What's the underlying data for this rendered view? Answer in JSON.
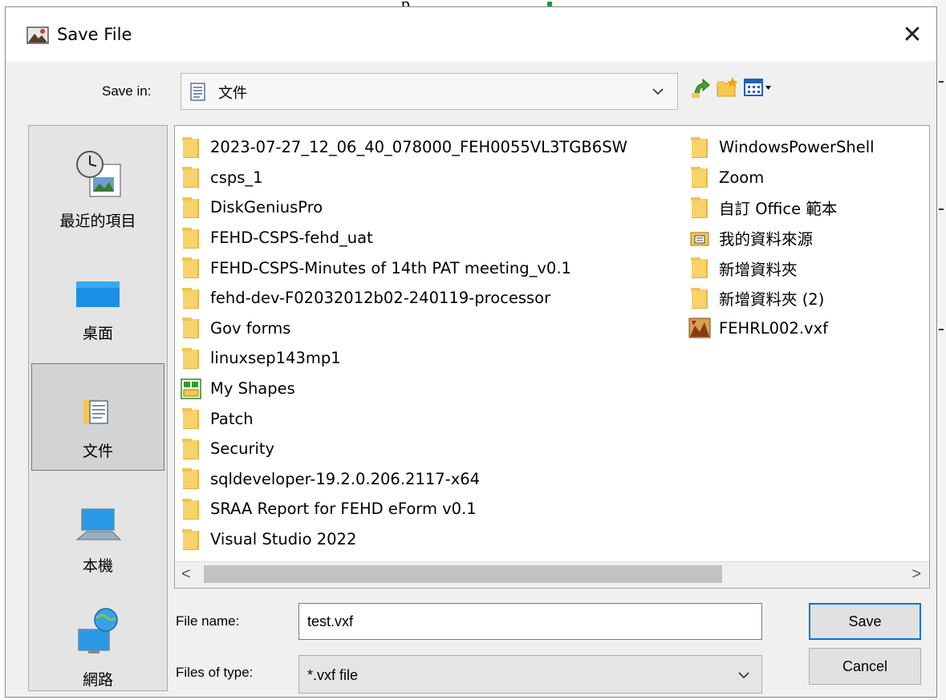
{
  "background": {
    "fragment_text": "p"
  },
  "dialog": {
    "title": "Save File",
    "close_glyph": "✕",
    "save_in": {
      "label": "Save in:",
      "value": "文件",
      "icon": "documents-folder-icon"
    },
    "toolbar": [
      "up-one-level-icon",
      "new-folder-icon",
      "view-menu-icon"
    ],
    "places": [
      {
        "label": "最近的項目",
        "icon": "recent-items-icon"
      },
      {
        "label": "桌面",
        "icon": "desktop-icon"
      },
      {
        "label": "文件",
        "icon": "documents-icon",
        "selected": true
      },
      {
        "label": "本機",
        "icon": "this-pc-icon"
      },
      {
        "label": "網路",
        "icon": "network-icon"
      }
    ],
    "files_col1": [
      {
        "name": "2023-07-27_12_06_40_078000_FEH0055VL3TGB6SW",
        "type": "folder"
      },
      {
        "name": "csps_1",
        "type": "folder"
      },
      {
        "name": "DiskGeniusPro",
        "type": "folder"
      },
      {
        "name": "FEHD-CSPS-fehd_uat",
        "type": "folder"
      },
      {
        "name": "FEHD-CSPS-Minutes of 14th PAT meeting_v0.1",
        "type": "folder"
      },
      {
        "name": "fehd-dev-F02032012b02-240119-processor",
        "type": "folder"
      },
      {
        "name": "Gov forms",
        "type": "folder"
      },
      {
        "name": "linuxsep143mp1",
        "type": "folder"
      },
      {
        "name": "My Shapes",
        "type": "special-folder"
      },
      {
        "name": "Patch",
        "type": "folder"
      },
      {
        "name": "Security",
        "type": "folder"
      },
      {
        "name": "sqldeveloper-19.2.0.206.2117-x64",
        "type": "folder"
      },
      {
        "name": "SRAA Report for FEHD eForm v0.1",
        "type": "folder"
      },
      {
        "name": "Visual Studio 2022",
        "type": "folder"
      }
    ],
    "files_col2": [
      {
        "name": "WindowsPowerShell",
        "type": "folder"
      },
      {
        "name": "Zoom",
        "type": "folder"
      },
      {
        "name": "自訂 Office 範本",
        "type": "folder"
      },
      {
        "name": "我的資料來源",
        "type": "data-source"
      },
      {
        "name": "新增資料夾",
        "type": "folder"
      },
      {
        "name": "新增資料夾 (2)",
        "type": "folder"
      },
      {
        "name": "FEHRL002.vxf",
        "type": "vxf-file"
      }
    ],
    "scroll": {
      "left_arrow": "<",
      "right_arrow": ">"
    },
    "file_name": {
      "label": "File name:",
      "value": "test.vxf"
    },
    "file_type": {
      "label": "Files of type:",
      "value": "*.vxf file"
    },
    "buttons": {
      "save": "Save",
      "cancel": "Cancel"
    }
  }
}
